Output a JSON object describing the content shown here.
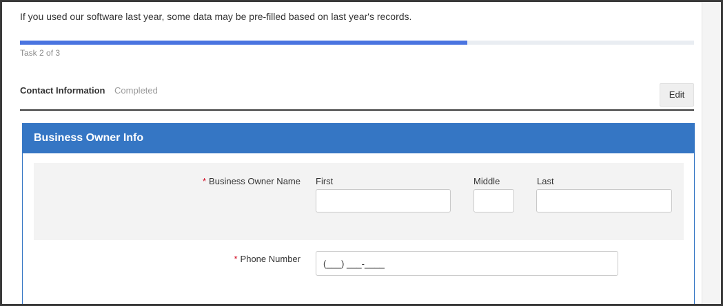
{
  "notice": "If you used our software last year, some data may be pre-filled based on last year's records.",
  "progress": {
    "label": "Task 2 of 3",
    "percent": 66.4,
    "accent": "#4a74e0"
  },
  "section": {
    "title": "Contact Information",
    "status": "Completed",
    "edit_label": "Edit"
  },
  "panel": {
    "title": "Business Owner Info",
    "header_color": "#3576c4",
    "owner_name": {
      "label": "Business Owner Name",
      "required_mark": "*",
      "first_label": "First",
      "middle_label": "Middle",
      "last_label": "Last",
      "first_value": "",
      "middle_value": "",
      "last_value": ""
    },
    "phone": {
      "label": "Phone Number",
      "required_mark": "*",
      "value": "(___) ___-____"
    }
  }
}
